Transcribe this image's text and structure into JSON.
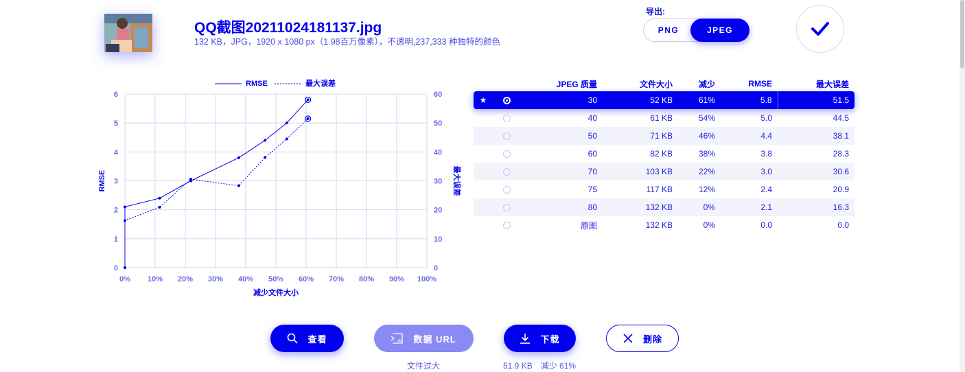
{
  "file": {
    "name": "QQ截图20211024181137.jpg",
    "meta": "132 KB，JPG，1920 x 1080 px（1.98百万像素），不透明,237,333 种独特的颜色"
  },
  "export": {
    "label": "导出:",
    "formats": [
      "PNG",
      "JPEG"
    ],
    "selected": "JPEG"
  },
  "table": {
    "headers": {
      "quality": "JPEG 质量",
      "size": "文件大小",
      "reduction": "减少",
      "rmse": "RMSE",
      "max_error": "最大误差"
    },
    "rows": [
      {
        "star": "★",
        "quality": "30",
        "size": "52 KB",
        "reduction": "61%",
        "rmse": "5.8",
        "max_error": "51.5",
        "selected": true
      },
      {
        "star": "",
        "quality": "40",
        "size": "61 KB",
        "reduction": "54%",
        "rmse": "5.0",
        "max_error": "44.5",
        "selected": false
      },
      {
        "star": "",
        "quality": "50",
        "size": "71 KB",
        "reduction": "46%",
        "rmse": "4.4",
        "max_error": "38.1",
        "selected": false
      },
      {
        "star": "",
        "quality": "60",
        "size": "82 KB",
        "reduction": "38%",
        "rmse": "3.8",
        "max_error": "28.3",
        "selected": false
      },
      {
        "star": "",
        "quality": "70",
        "size": "103 KB",
        "reduction": "22%",
        "rmse": "3.0",
        "max_error": "30.6",
        "selected": false
      },
      {
        "star": "",
        "quality": "75",
        "size": "117 KB",
        "reduction": "12%",
        "rmse": "2.4",
        "max_error": "20.9",
        "selected": false
      },
      {
        "star": "",
        "quality": "80",
        "size": "132 KB",
        "reduction": "0%",
        "rmse": "2.1",
        "max_error": "16.3",
        "selected": false
      },
      {
        "star": "",
        "quality": "原图",
        "size": "132 KB",
        "reduction": "0%",
        "rmse": "0.0",
        "max_error": "0.0",
        "selected": false
      }
    ]
  },
  "actions": {
    "view": "查看",
    "data_url": "数据 URL",
    "download": "下载",
    "delete": "删除",
    "data_url_note": "文件过大",
    "download_note": "51.9 KB　减少 61%"
  },
  "chart_data": {
    "type": "line",
    "xlabel": "减少文件大小",
    "ylabel": "RMSE",
    "y2label": "最大误差",
    "xlim": [
      0,
      100
    ],
    "ylim": [
      0,
      6
    ],
    "y2lim": [
      0,
      60
    ],
    "x_ticks": [
      "0%",
      "10%",
      "20%",
      "30%",
      "40%",
      "50%",
      "60%",
      "70%",
      "80%",
      "90%",
      "100%"
    ],
    "y_ticks": [
      "0",
      "1",
      "2",
      "3",
      "4",
      "5",
      "6"
    ],
    "y2_ticks": [
      "0",
      "10",
      "20",
      "30",
      "40",
      "50",
      "60"
    ],
    "legend_position": "top-center",
    "grid": true,
    "series": [
      {
        "name": "RMSE",
        "axis": "left",
        "style": "solid",
        "points": [
          [
            0,
            0.0
          ],
          [
            0,
            2.1
          ],
          [
            11.5,
            2.4
          ],
          [
            21.8,
            3.0
          ],
          [
            37.7,
            3.8
          ],
          [
            46.4,
            4.4
          ],
          [
            53.6,
            5.0
          ],
          [
            60.6,
            5.8
          ]
        ]
      },
      {
        "name": "最大误差",
        "axis": "right",
        "style": "dotted",
        "points": [
          [
            0,
            0.0
          ],
          [
            0,
            16.3
          ],
          [
            11.5,
            20.9
          ],
          [
            21.8,
            30.6
          ],
          [
            37.7,
            28.3
          ],
          [
            46.4,
            38.1
          ],
          [
            53.6,
            44.5
          ],
          [
            60.6,
            51.5
          ]
        ]
      }
    ],
    "highlight_index": 7
  }
}
